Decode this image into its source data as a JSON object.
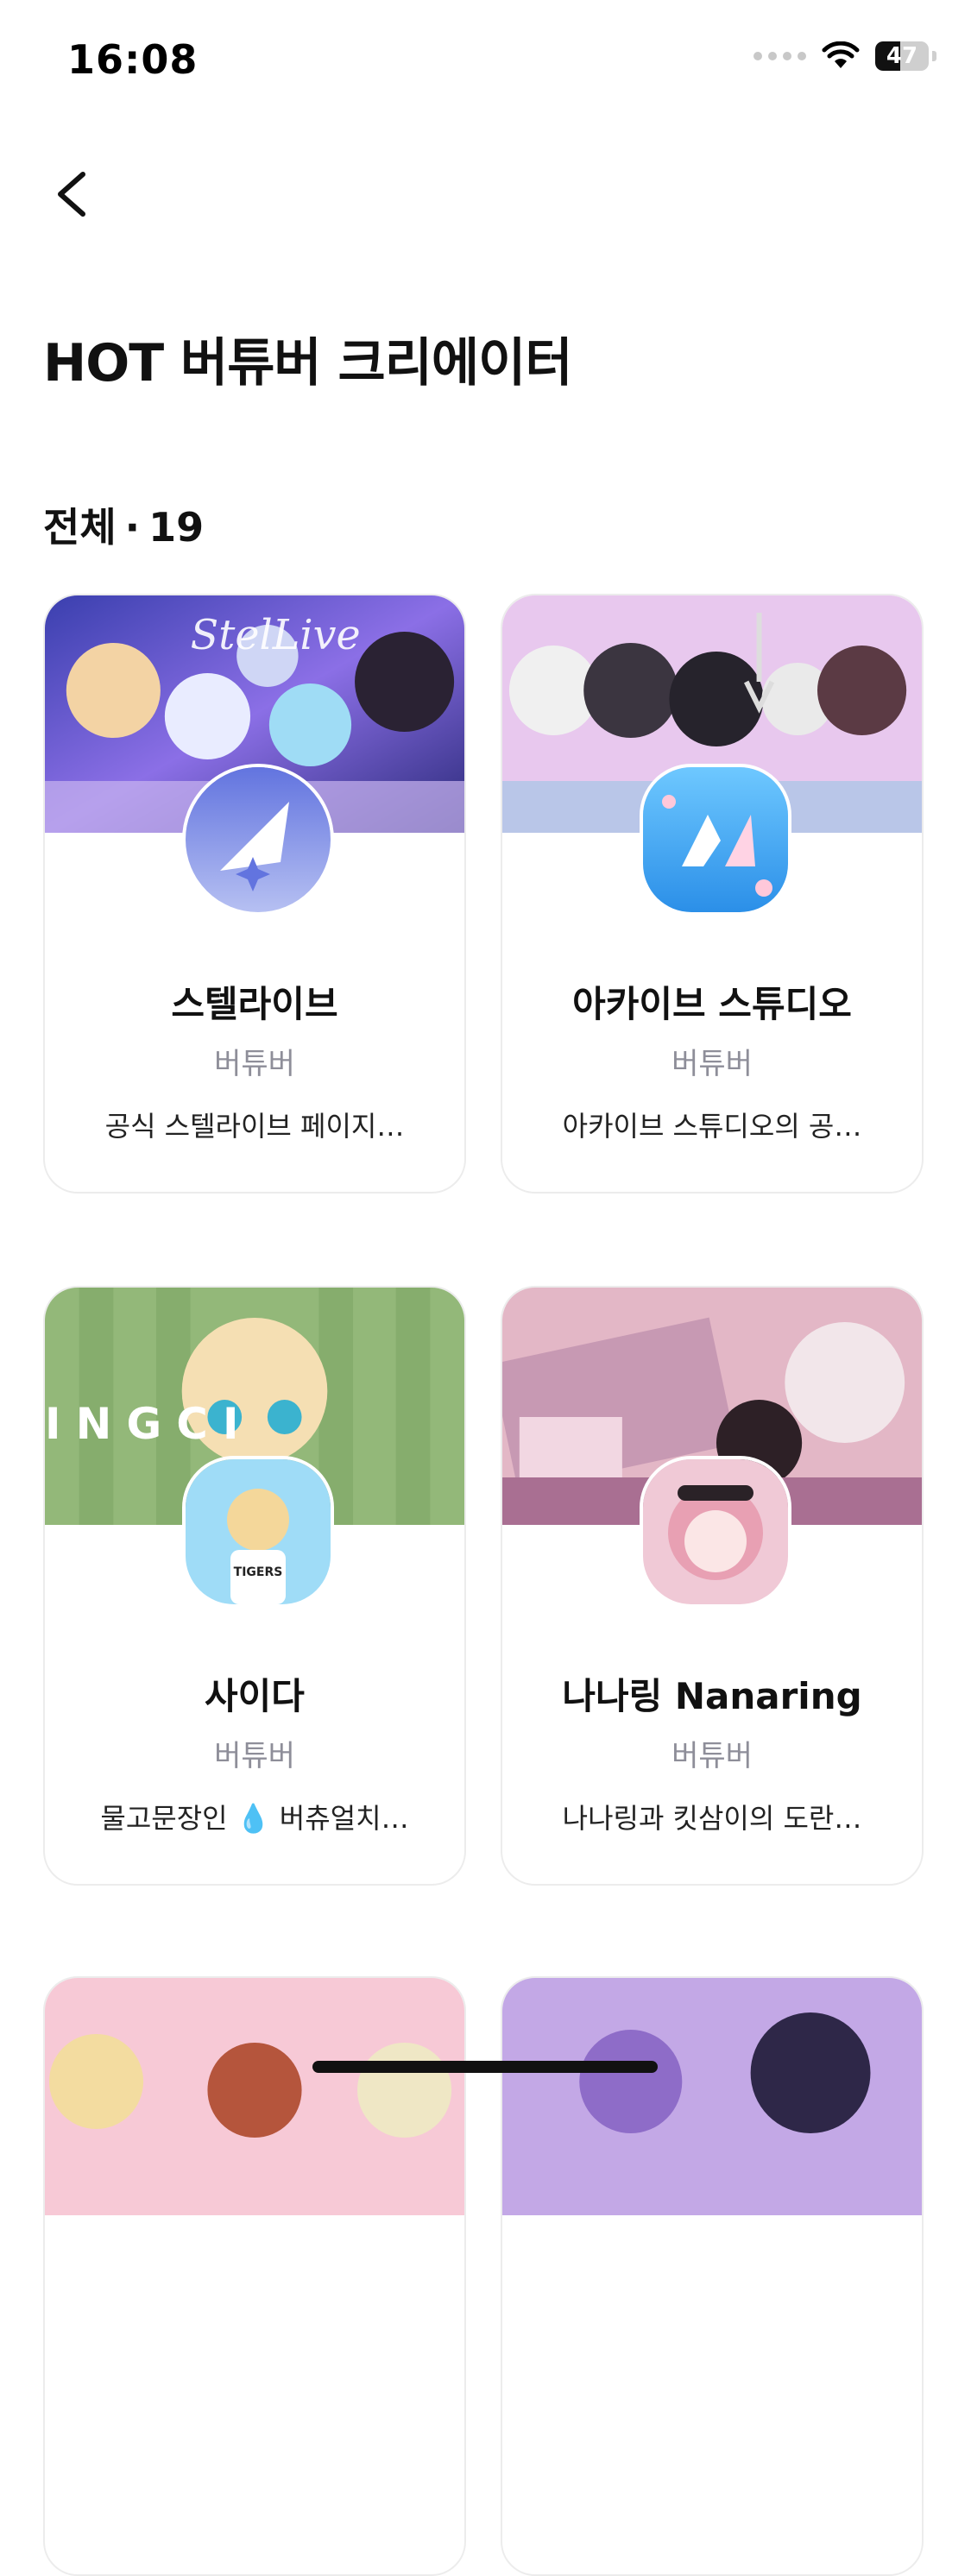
{
  "status_bar": {
    "time": "16:08",
    "battery": "47",
    "battery_level": 0.47
  },
  "header": {
    "title": "HOT 버튜버 크리에이터"
  },
  "count": {
    "label": "전체",
    "separator": "·",
    "value": "19"
  },
  "cards": [
    {
      "name": "스텔라이브",
      "category": "버튜버",
      "description": "공식 스텔라이브 페이지…",
      "banner_text": "StelLive"
    },
    {
      "name": "아카이브 스튜디오",
      "category": "버튜버",
      "description": "아카이브 스튜디오의 공…"
    },
    {
      "name": "사이다",
      "category": "버튜버",
      "description": "물고문장인 💧 버츄얼치…",
      "banner_text": "I N G              C I",
      "avatar_text": "TIGERS"
    },
    {
      "name": "나나링 Nanaring",
      "category": "버튜버",
      "description": "나나링과 킷삼이의 도란…"
    }
  ],
  "icons": [
    "back-arrow-icon",
    "wifi-icon",
    "battery-icon",
    "signal-dots-icon"
  ],
  "colors": {
    "accent_blue": "#6b7fe0",
    "category_gray": "#8e8e99",
    "card_border": "#ececec"
  }
}
